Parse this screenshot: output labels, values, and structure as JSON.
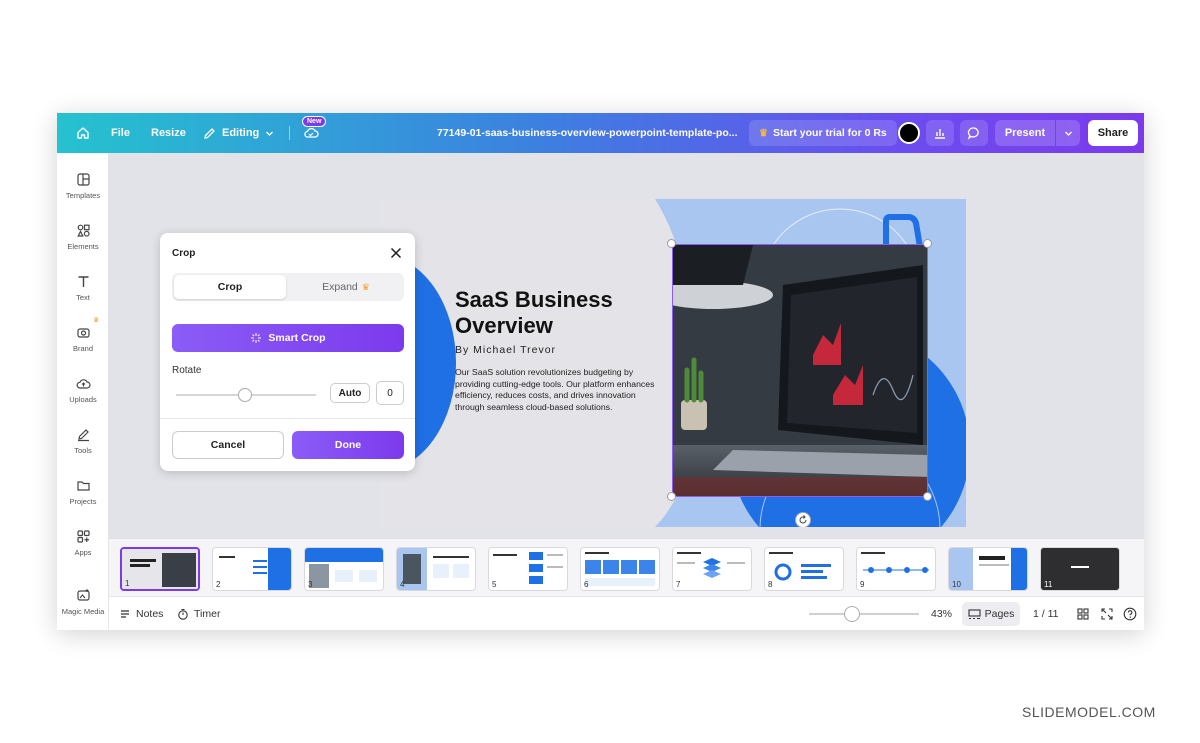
{
  "topbar": {
    "file": "File",
    "resize": "Resize",
    "editing": "Editing",
    "new_badge": "New",
    "doc_name": "77149-01-saas-business-overview-powerpoint-template-po...",
    "trial": "Start your trial for 0 Rs",
    "present": "Present",
    "share": "Share",
    "accent_color": "#7c3aed"
  },
  "sidebar": {
    "items": [
      {
        "label": "Templates",
        "icon": "templates-icon"
      },
      {
        "label": "Elements",
        "icon": "elements-icon"
      },
      {
        "label": "Text",
        "icon": "text-icon"
      },
      {
        "label": "Brand",
        "icon": "brand-icon"
      },
      {
        "label": "Uploads",
        "icon": "uploads-icon"
      },
      {
        "label": "Tools",
        "icon": "tools-icon"
      },
      {
        "label": "Projects",
        "icon": "projects-icon"
      },
      {
        "label": "Apps",
        "icon": "apps-icon"
      },
      {
        "label": "Magic Media",
        "icon": "magic-media-icon"
      }
    ]
  },
  "crop_panel": {
    "title": "Crop",
    "tab_crop": "Crop",
    "tab_expand": "Expand",
    "smart_crop": "Smart Crop",
    "rotate_label": "Rotate",
    "auto": "Auto",
    "rotate_value": "0",
    "rotate_level": 0.5,
    "cancel": "Cancel",
    "done": "Done"
  },
  "slide": {
    "title": "SaaS Business Overview",
    "author": "By Michael Trevor",
    "body": "Our SaaS solution revolutionizes budgeting by providing cutting-edge tools. Our platform enhances efficiency, reduces costs, and drives innovation through seamless cloud-based solutions."
  },
  "pages": {
    "thumbs": [
      {
        "num": "1",
        "label": "SaaS Business Overview",
        "active": true
      },
      {
        "num": "2",
        "label": "Agenda"
      },
      {
        "num": "3",
        "label": "Company Mission & Vision"
      },
      {
        "num": "4",
        "label": "Problem Statement & Solution"
      },
      {
        "num": "5",
        "label": "Core Products & Services"
      },
      {
        "num": "6",
        "label": "Business Metrics"
      },
      {
        "num": "7",
        "label": "Revenue Model"
      },
      {
        "num": "8",
        "label": "Key Metrics"
      },
      {
        "num": "9",
        "label": "Milestones"
      },
      {
        "num": "10",
        "label": "Thank You"
      },
      {
        "num": "11",
        "label": ""
      }
    ]
  },
  "bottombar": {
    "notes": "Notes",
    "timer": "Timer",
    "zoom": "43%",
    "pages": "Pages",
    "page_count": "1 / 11"
  },
  "watermark": "SLIDEMODEL.COM"
}
